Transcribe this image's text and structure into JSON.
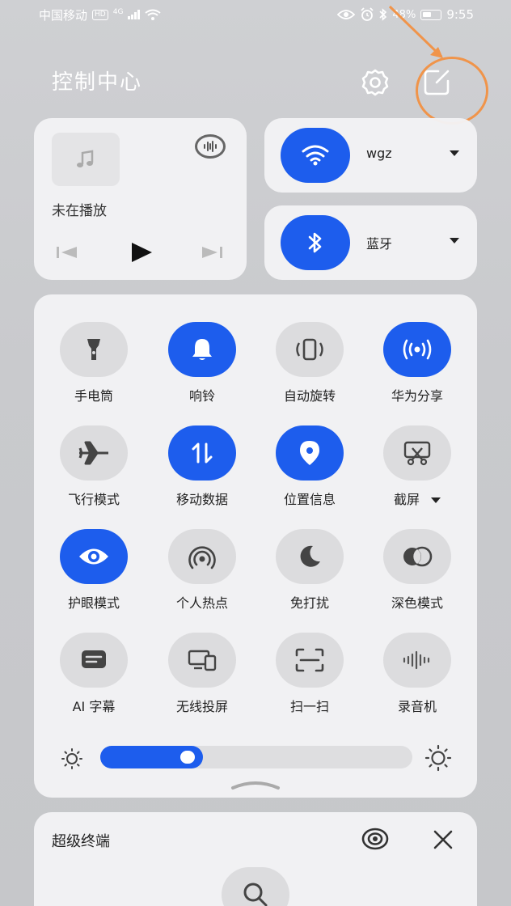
{
  "status_bar": {
    "carrier": "中国移动",
    "hd": "HD",
    "network": "4G",
    "battery_text": "48%",
    "time": "9:55"
  },
  "header": {
    "title": "控制中心"
  },
  "media": {
    "title": "未在播放"
  },
  "wifi": {
    "label": "wgz",
    "enabled": true
  },
  "bluetooth": {
    "label": "蓝牙",
    "enabled": true
  },
  "tiles": [
    {
      "label": "手电筒",
      "icon": "flashlight-icon",
      "on": false
    },
    {
      "label": "响铃",
      "icon": "bell-icon",
      "on": true
    },
    {
      "label": "自动旋转",
      "icon": "rotate-icon",
      "on": false
    },
    {
      "label": "华为分享",
      "icon": "share-icon",
      "on": true
    },
    {
      "label": "飞行模式",
      "icon": "airplane-icon",
      "on": false
    },
    {
      "label": "移动数据",
      "icon": "mobile-data-icon",
      "on": true
    },
    {
      "label": "位置信息",
      "icon": "location-icon",
      "on": true
    },
    {
      "label": "截屏",
      "icon": "screenshot-icon",
      "on": false
    },
    {
      "label": "护眼模式",
      "icon": "eye-icon",
      "on": true
    },
    {
      "label": "个人热点",
      "icon": "hotspot-icon",
      "on": false
    },
    {
      "label": "免打扰",
      "icon": "moon-icon",
      "on": false
    },
    {
      "label": "深色模式",
      "icon": "dark-mode-icon",
      "on": false
    },
    {
      "label": "AI 字幕",
      "icon": "subtitle-icon",
      "on": false
    },
    {
      "label": "无线投屏",
      "icon": "cast-screen-icon",
      "on": false
    },
    {
      "label": "扫一扫",
      "icon": "scan-icon",
      "on": false
    },
    {
      "label": "录音机",
      "icon": "recorder-icon",
      "on": false
    }
  ],
  "brightness": {
    "level": 0.33
  },
  "super_device": {
    "title": "超级终端"
  },
  "colors": {
    "accent": "#1d5ded",
    "annotation": "#f0944a"
  }
}
